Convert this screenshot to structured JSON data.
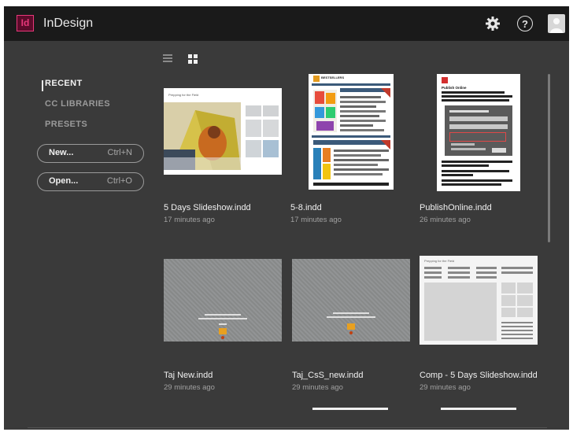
{
  "app": {
    "title": "InDesign",
    "logo_text": "Id",
    "accent": "#e8387a"
  },
  "titlebar_icons": [
    "gear-icon",
    "help-icon",
    "user-avatar-icon"
  ],
  "help_glyph": "?",
  "view_icons": [
    "list-view-icon",
    "grid-view-icon"
  ],
  "sidebar": {
    "items": [
      {
        "label": "RECENT",
        "active": true
      },
      {
        "label": "CC LIBRARIES",
        "active": false
      },
      {
        "label": "PRESETS",
        "active": false
      }
    ],
    "new_button": {
      "label": "New...",
      "shortcut": "Ctrl+N"
    },
    "open_button": {
      "label": "Open...",
      "shortcut": "Ctrl+O"
    }
  },
  "files": [
    {
      "name": "5 Days Slideshow.indd",
      "time": "17 minutes ago",
      "thumb_heading": "Prepping for the Field"
    },
    {
      "name": "5-8.indd",
      "time": "17 minutes ago",
      "thumb_heading": "BESTSELLERS"
    },
    {
      "name": "PublishOnline.indd",
      "time": "26 minutes ago",
      "thumb_heading": "Publish Online"
    },
    {
      "name": "Taj New.indd",
      "time": "29 minutes ago"
    },
    {
      "name": "Taj_CsS_new.indd",
      "time": "29 minutes ago"
    },
    {
      "name": "Comp - 5 Days Slideshow.indd",
      "time": "29 minutes ago",
      "thumb_heading": "Prepping for the Field"
    }
  ]
}
